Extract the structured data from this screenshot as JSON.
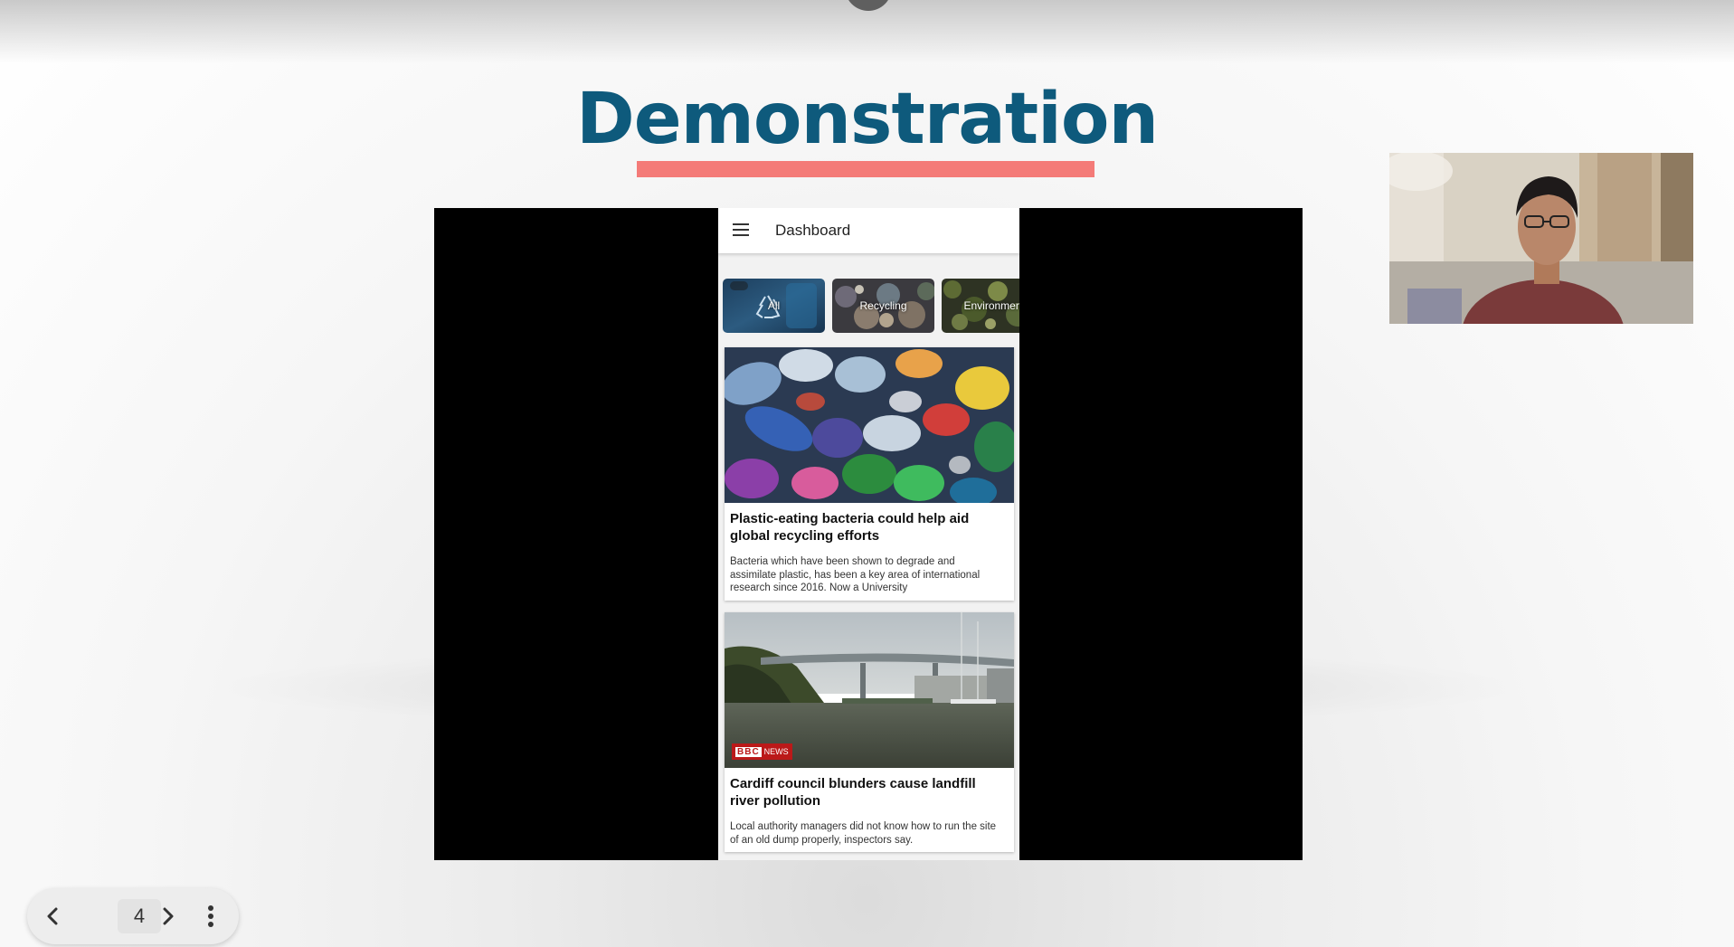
{
  "slide": {
    "title": "Demonstration",
    "accent_color": "#f47b78",
    "title_color": "#0e5a7c"
  },
  "app": {
    "header": {
      "menu_icon": "hamburger-menu-icon",
      "title": "Dashboard"
    },
    "categories": [
      {
        "label": "All",
        "icon": "recycle-icon",
        "selected": true
      },
      {
        "label": "Recycling",
        "selected": false
      },
      {
        "label": "Environmen",
        "selected": false
      }
    ],
    "articles": [
      {
        "image": "plastic-bottles-image",
        "title": "Plastic-eating bacteria could help aid global recycling efforts",
        "description": "Bacteria which have been shown to degrade and assimilate plastic, has been a key area of international research since 2016. Now a University"
      },
      {
        "image": "river-bridge-image",
        "source_badge": {
          "brand": "BBC",
          "label": "NEWS"
        },
        "title": "Cardiff council blunders cause landfill river pollution",
        "description": "Local authority managers did not know how to run the site of an old dump properly, inspectors say."
      }
    ]
  },
  "presenter": {
    "webcam": "presenter-webcam-video"
  },
  "navigation": {
    "prev_icon": "chevron-left-icon",
    "page": "4",
    "next_icon": "chevron-right-icon",
    "more_icon": "more-vertical-icon"
  }
}
